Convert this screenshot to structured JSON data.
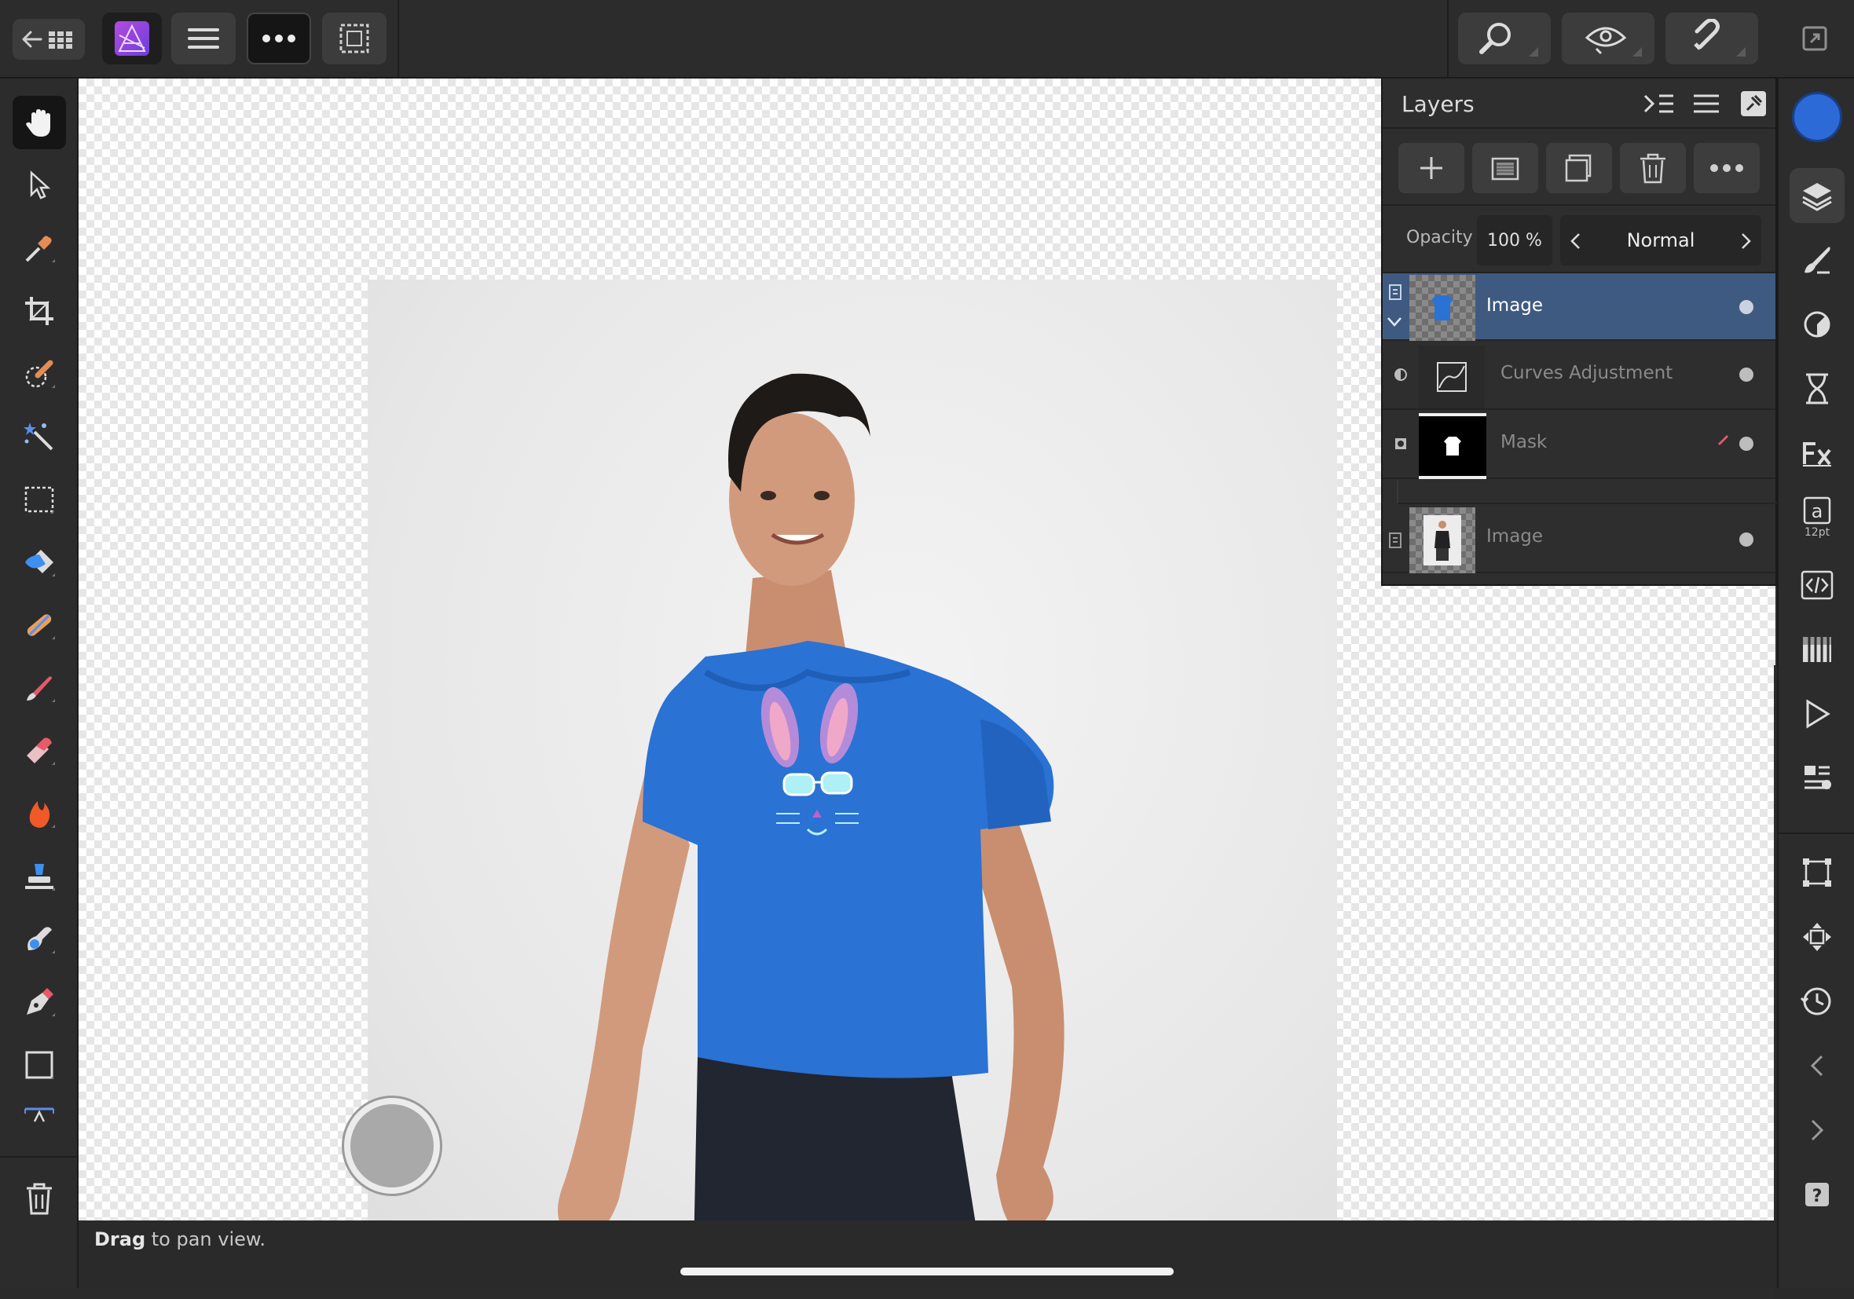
{
  "layers_panel": {
    "title": "Layers",
    "opacity_label": "Opacity",
    "opacity_value": "100 %",
    "blend_mode": "Normal",
    "layers": [
      {
        "name": "Image",
        "selected": true
      },
      {
        "name": "Curves Adjustment",
        "selected": false
      },
      {
        "name": "Mask",
        "selected": false
      },
      {
        "name": "Image",
        "selected": false
      }
    ]
  },
  "studio": {
    "text_size_label": "12pt"
  },
  "status": {
    "action": "Drag",
    "hint": " to pan view."
  },
  "colors": {
    "accent_blue": "#3f5a80",
    "primary_color_swatch": "#2c6ad8",
    "app_bg": "#2c2c2c"
  }
}
